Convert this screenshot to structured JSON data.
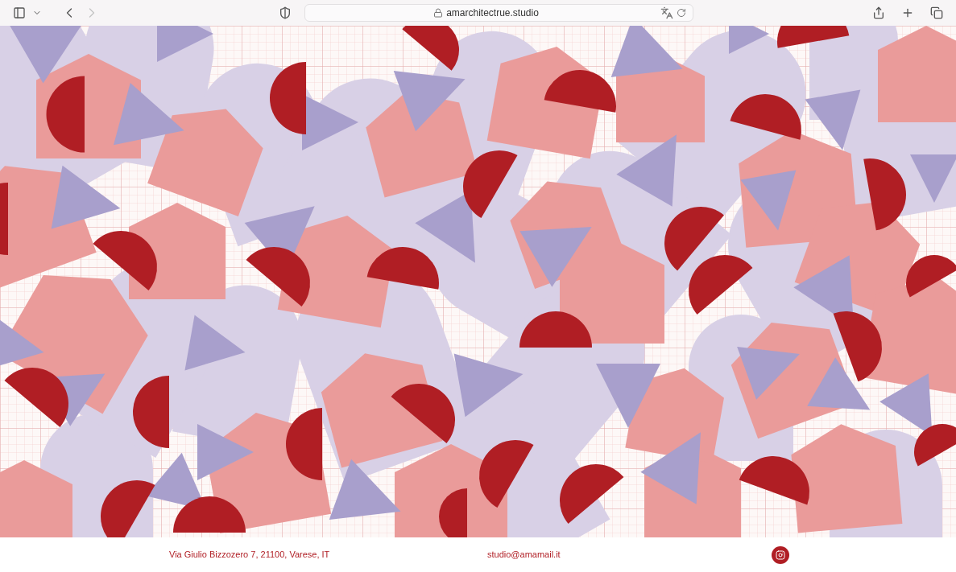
{
  "browser": {
    "url": "amarchitectrue.studio",
    "nav": [
      {
        "kind": "back",
        "disabled": false
      },
      {
        "kind": "forward",
        "disabled": true
      }
    ]
  },
  "footer": {
    "address": "Via Giulio Bizzozero 7, 21100, Varese, IT",
    "email": "studio@amamail.it"
  }
}
